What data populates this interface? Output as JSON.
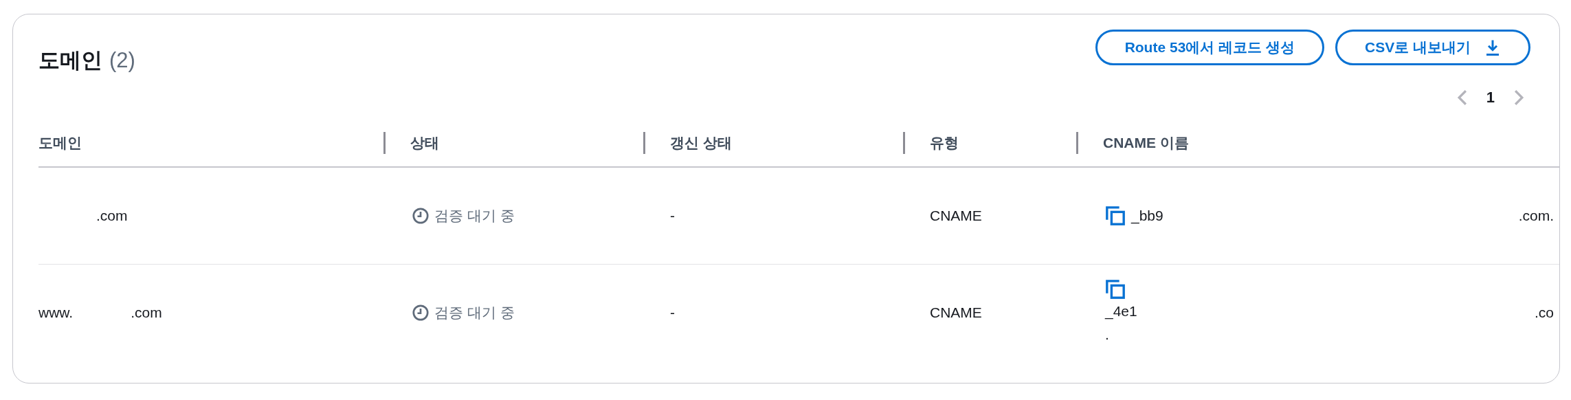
{
  "header": {
    "title": "도메인",
    "count": "(2)",
    "buttons": [
      {
        "label": "Route 53에서 레코드 생성",
        "kind": "create"
      },
      {
        "label": "CSV로 내보내기",
        "kind": "export"
      }
    ]
  },
  "pagination": {
    "prev_disabled": true,
    "next_disabled": true,
    "pages": [
      {
        "label": "1",
        "selected": true
      }
    ]
  },
  "table": {
    "columns": [
      "도메인",
      "상태",
      "갱신 상태",
      "유형",
      "CNAME 이름"
    ],
    "rows": [
      {
        "domain": [
          {
            "text": ".com",
            "kind": "suffix"
          }
        ],
        "status": {
          "text": "검증 대기 중",
          "kind": "pending"
        },
        "renewal": "-",
        "type": "CNAME",
        "cname": {
          "lines": [
            "_bb9"
          ],
          "tail": ".com."
        }
      },
      {
        "domain": [
          {
            "text": "www.",
            "kind": "prefix"
          },
          {
            "text": ".com",
            "kind": "suffix"
          }
        ],
        "status": {
          "text": "검증 대기 중",
          "kind": "pending"
        },
        "renewal": "-",
        "type": "CNAME",
        "cname": {
          "lines": [
            "_4e1",
            "."
          ],
          "tail": ".co"
        }
      }
    ]
  }
}
